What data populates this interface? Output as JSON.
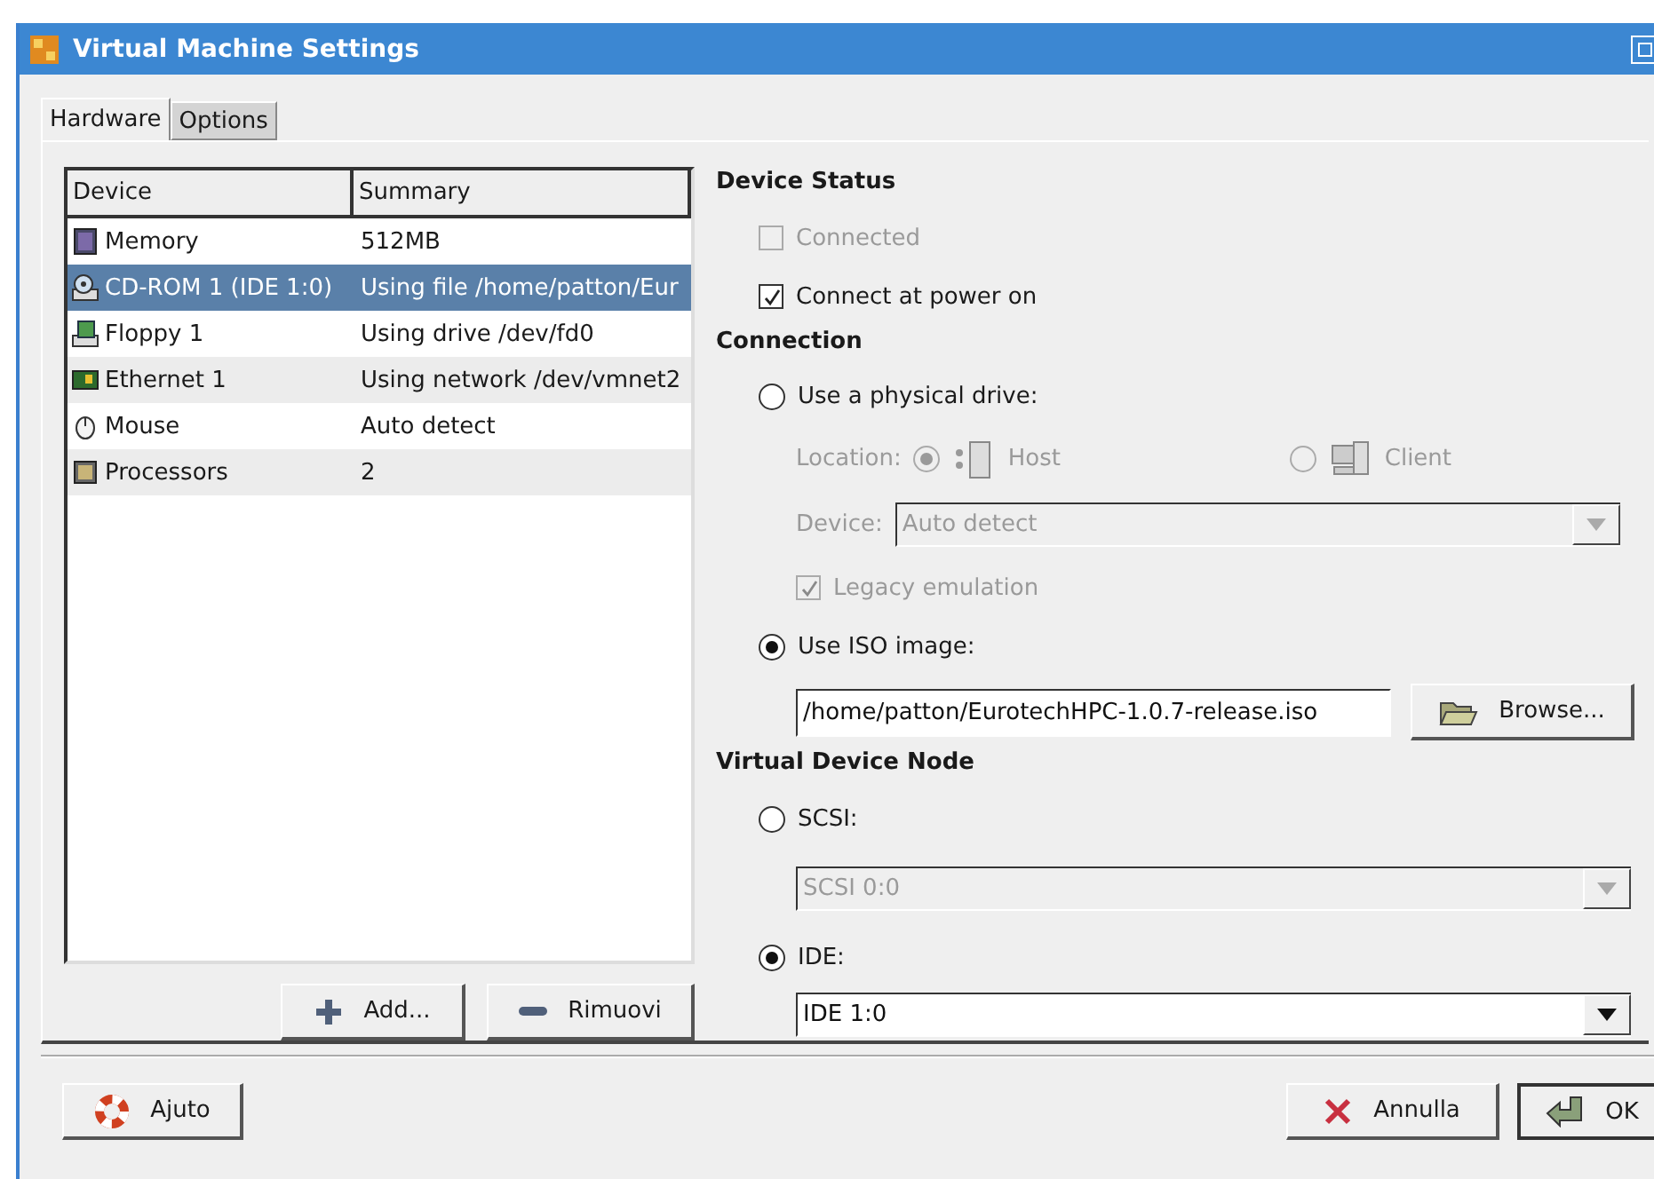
{
  "window": {
    "title": "Virtual Machine Settings"
  },
  "tabs": [
    {
      "label": "Hardware",
      "selected": true
    },
    {
      "label": "Options",
      "selected": false
    }
  ],
  "device_table": {
    "columns": [
      "Device",
      "Summary"
    ],
    "rows": [
      {
        "device": "Memory",
        "summary": "512MB",
        "selected": false
      },
      {
        "device": "CD-ROM 1 (IDE 1:0)",
        "summary": "Using file /home/patton/Eur",
        "selected": true
      },
      {
        "device": "Floppy 1",
        "summary": "Using drive /dev/fd0",
        "selected": false
      },
      {
        "device": "Ethernet 1",
        "summary": "Using network /dev/vmnet2",
        "selected": false
      },
      {
        "device": "Mouse",
        "summary": "Auto detect",
        "selected": false
      },
      {
        "device": "Processors",
        "summary": "2",
        "selected": false
      }
    ]
  },
  "list_buttons": [
    "Add...",
    "Rimuovi"
  ],
  "sections": [
    {
      "title": "Device Status",
      "items": [
        {
          "kind": "checkbox",
          "label": "Connected",
          "checked": false,
          "disabled": true
        },
        {
          "kind": "checkbox",
          "label": "Connect at power on",
          "checked": true,
          "disabled": false
        }
      ]
    },
    {
      "title": "Connection",
      "items": [
        {
          "kind": "radio",
          "label": "Use a physical drive:",
          "selected": false,
          "disabled": false
        },
        {
          "kind": "location",
          "label": "Location:",
          "disabled": true,
          "options": [
            {
              "label": "Host",
              "selected": true
            },
            {
              "label": "Client",
              "selected": false
            }
          ]
        },
        {
          "kind": "labeled_combo",
          "label": "Device:",
          "value": "Auto detect",
          "disabled": true
        },
        {
          "kind": "sub_checkbox",
          "label": "Legacy emulation",
          "checked": true,
          "disabled": true
        },
        {
          "kind": "radio",
          "label": "Use ISO image:",
          "selected": true,
          "disabled": false
        },
        {
          "kind": "file",
          "value": "/home/patton/EurotechHPC-1.0.7-release.iso",
          "button": "Browse..."
        }
      ]
    },
    {
      "title": "Virtual Device Node",
      "items": [
        {
          "kind": "radio",
          "label": "SCSI:",
          "selected": false,
          "disabled": false
        },
        {
          "kind": "combo",
          "value": "SCSI 0:0",
          "disabled": true
        },
        {
          "kind": "radio",
          "label": "IDE:",
          "selected": true,
          "disabled": false
        },
        {
          "kind": "combo",
          "value": "IDE 1:0",
          "disabled": false
        }
      ]
    }
  ],
  "footer": {
    "help": "Ajuto",
    "cancel": "Annulla",
    "ok": "OK"
  }
}
